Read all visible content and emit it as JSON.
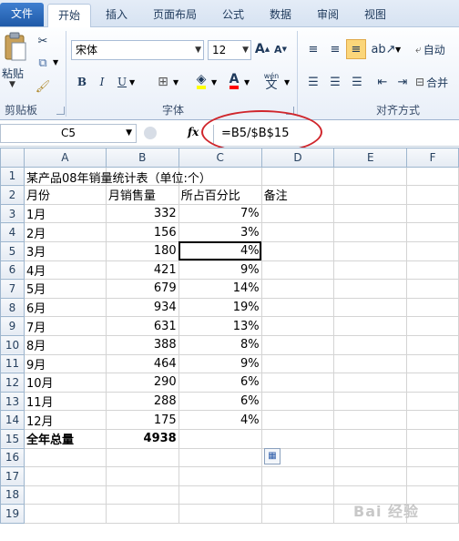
{
  "tabs": [
    "文件",
    "开始",
    "插入",
    "页面布局",
    "公式",
    "数据",
    "审阅",
    "视图"
  ],
  "ribbon": {
    "paste_label": "粘贴",
    "clipboard_label": "剪贴板",
    "font_label": "字体",
    "align_label": "对齐方式",
    "font_name": "宋体",
    "font_size": "12",
    "wrap_label": "自动",
    "merge_label": "合并",
    "wen_label": "wén",
    "wen_char": "文",
    "grow_font": "A",
    "shrink_font": "A",
    "bold": "B",
    "italic": "I",
    "underline": "U",
    "font_color": "A"
  },
  "formula_bar": {
    "name_box": "C5",
    "fx": "fx",
    "formula": "=B5/$B$15"
  },
  "columns": [
    "A",
    "B",
    "C",
    "D",
    "E",
    "F"
  ],
  "rows": [
    {
      "n": "1",
      "a": "某产品08年销量统计表（单位:个）",
      "b": "",
      "c": "",
      "d": ""
    },
    {
      "n": "2",
      "a": "月份",
      "b": "月销售量",
      "c": "所占百分比",
      "d": "备注"
    },
    {
      "n": "3",
      "a": "1月",
      "b": "332",
      "c": "7%",
      "d": ""
    },
    {
      "n": "4",
      "a": "2月",
      "b": "156",
      "c": "3%",
      "d": ""
    },
    {
      "n": "5",
      "a": "3月",
      "b": "180",
      "c": "4%",
      "d": ""
    },
    {
      "n": "6",
      "a": "4月",
      "b": "421",
      "c": "9%",
      "d": ""
    },
    {
      "n": "7",
      "a": "5月",
      "b": "679",
      "c": "14%",
      "d": ""
    },
    {
      "n": "8",
      "a": "6月",
      "b": "934",
      "c": "19%",
      "d": ""
    },
    {
      "n": "9",
      "a": "7月",
      "b": "631",
      "c": "13%",
      "d": ""
    },
    {
      "n": "10",
      "a": "8月",
      "b": "388",
      "c": "8%",
      "d": ""
    },
    {
      "n": "11",
      "a": "9月",
      "b": "464",
      "c": "9%",
      "d": ""
    },
    {
      "n": "12",
      "a": "10月",
      "b": "290",
      "c": "6%",
      "d": ""
    },
    {
      "n": "13",
      "a": "11月",
      "b": "288",
      "c": "6%",
      "d": ""
    },
    {
      "n": "14",
      "a": "12月",
      "b": "175",
      "c": "4%",
      "d": ""
    },
    {
      "n": "15",
      "a": "全年总量",
      "b": "4938",
      "c": "",
      "d": ""
    },
    {
      "n": "16",
      "a": "",
      "b": "",
      "c": "",
      "d": ""
    },
    {
      "n": "17",
      "a": "",
      "b": "",
      "c": "",
      "d": ""
    },
    {
      "n": "18",
      "a": "",
      "b": "",
      "c": "",
      "d": ""
    },
    {
      "n": "19",
      "a": "",
      "b": "",
      "c": "",
      "d": ""
    }
  ],
  "watermark": "Bai 经验",
  "colors": {
    "accent": "#1f5aa8",
    "selected_header": "#f1c15f",
    "annotation": "#d0262c"
  }
}
